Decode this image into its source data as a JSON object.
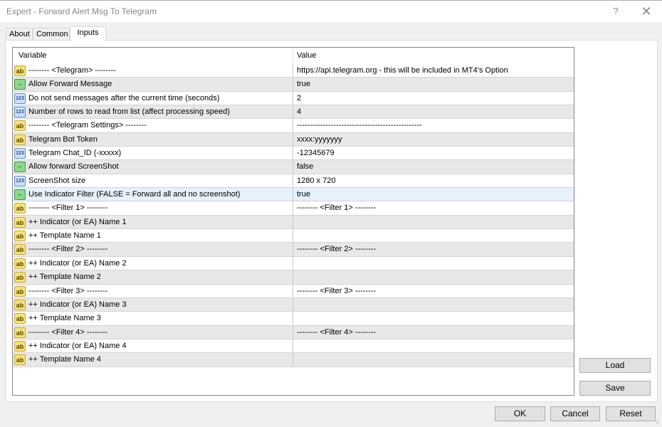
{
  "window": {
    "title": "Expert - Forward Alert Msg To Telegram",
    "help_icon": "?",
    "close_icon": "✕"
  },
  "tabs": [
    {
      "label": "About",
      "active": false
    },
    {
      "label": "Common",
      "active": false
    },
    {
      "label": "Inputs",
      "active": true
    }
  ],
  "table": {
    "columns": [
      "Variable",
      "Value"
    ],
    "rows": [
      {
        "type": "string",
        "icon": "ab",
        "variable": "-------- <Telegram> --------",
        "value": "https://api.telegram.org - this will be included in MT4's Option"
      },
      {
        "type": "bool",
        "icon": "⌐",
        "variable": "Allow Forward Message",
        "value": "true"
      },
      {
        "type": "int",
        "icon": "123",
        "variable": "Do not send messages after the current time (seconds)",
        "value": "2"
      },
      {
        "type": "int",
        "icon": "123",
        "variable": "Number of rows to read from list (affect processing speed)",
        "value": "4"
      },
      {
        "type": "string",
        "icon": "ab",
        "variable": "-------- <Telegram Settings> --------",
        "value": "------------------------------------------------"
      },
      {
        "type": "string",
        "icon": "ab",
        "variable": "Telegram Bot Token",
        "value": "xxxx:yyyyyyy"
      },
      {
        "type": "int",
        "icon": "123",
        "variable": "Telegram Chat_ID (-xxxxx)",
        "value": "-12345679"
      },
      {
        "type": "bool",
        "icon": "⌐",
        "variable": "Allow forward ScreenShot",
        "value": "false"
      },
      {
        "type": "int",
        "icon": "123",
        "variable": "ScreenShot size",
        "value": "1280 x 720"
      },
      {
        "type": "bool",
        "icon": "⌐",
        "variable": "Use Indicator Filter (FALSE = Forward all and no screenshot)",
        "value": "true",
        "selected": true
      },
      {
        "type": "string",
        "icon": "ab",
        "variable": "-------- <Filter 1> --------",
        "value": "-------- <Filter 1> --------"
      },
      {
        "type": "string",
        "icon": "ab",
        "variable": "++ Indicator (or EA) Name 1",
        "value": ""
      },
      {
        "type": "string",
        "icon": "ab",
        "variable": "++ Template Name 1",
        "value": ""
      },
      {
        "type": "string",
        "icon": "ab",
        "variable": "-------- <Filter 2> --------",
        "value": "-------- <Filter 2> --------"
      },
      {
        "type": "string",
        "icon": "ab",
        "variable": "++ Indicator (or EA) Name 2",
        "value": ""
      },
      {
        "type": "string",
        "icon": "ab",
        "variable": "++ Template Name 2",
        "value": ""
      },
      {
        "type": "string",
        "icon": "ab",
        "variable": "-------- <Filter 3> --------",
        "value": "-------- <Filter 3> --------"
      },
      {
        "type": "string",
        "icon": "ab",
        "variable": "++ Indicator (or EA) Name 3",
        "value": ""
      },
      {
        "type": "string",
        "icon": "ab",
        "variable": "++ Template Name 3",
        "value": ""
      },
      {
        "type": "string",
        "icon": "ab",
        "variable": "-------- <Filter 4> --------",
        "value": "-------- <Filter 4> --------"
      },
      {
        "type": "string",
        "icon": "ab",
        "variable": "++ Indicator (or EA) Name 4",
        "value": ""
      },
      {
        "type": "string",
        "icon": "ab",
        "variable": "++ Template Name 4",
        "value": ""
      }
    ]
  },
  "buttons": {
    "load": "Load",
    "save": "Save",
    "ok": "OK",
    "cancel": "Cancel",
    "reset": "Reset"
  }
}
